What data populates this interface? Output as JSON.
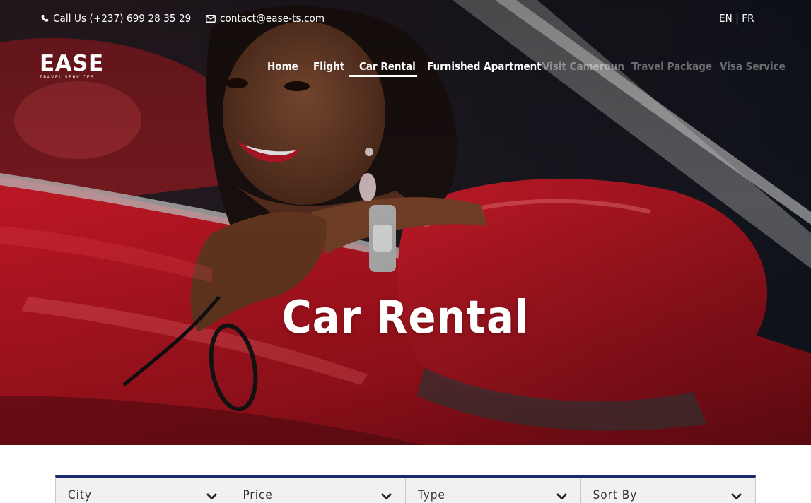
{
  "topbar": {
    "phone_icon": "phone-icon",
    "phone": "Call Us (+237) 699 28 35 29",
    "email_icon": "envelope-icon",
    "email": "contact@ease-ts.com",
    "lang": "EN | FR"
  },
  "logo": {
    "text": "EASE",
    "subtext": "TRAVEL SERVICES"
  },
  "nav": {
    "items": [
      {
        "label": "Home"
      },
      {
        "label": "Flight"
      },
      {
        "label": "Car Rental"
      },
      {
        "label": "Furnished Apartment"
      },
      {
        "label": "Visit Cameroun"
      },
      {
        "label": "Travel Package"
      },
      {
        "label": "Visa Service"
      }
    ],
    "active": "Car Rental"
  },
  "hero": {
    "title": "Car Rental"
  },
  "filters": [
    {
      "label": "City",
      "icon": "chevron-down-icon"
    },
    {
      "label": "Price",
      "icon": "chevron-down-icon"
    },
    {
      "label": "Type",
      "icon": "chevron-down-icon"
    },
    {
      "label": "Sort By",
      "icon": "chevron-down-icon"
    }
  ],
  "colors": {
    "filter_accent": "#1a2a6c",
    "car_red": "#b3141f",
    "text_white": "#ffffff",
    "filter_bg": "#f1f1f1"
  }
}
